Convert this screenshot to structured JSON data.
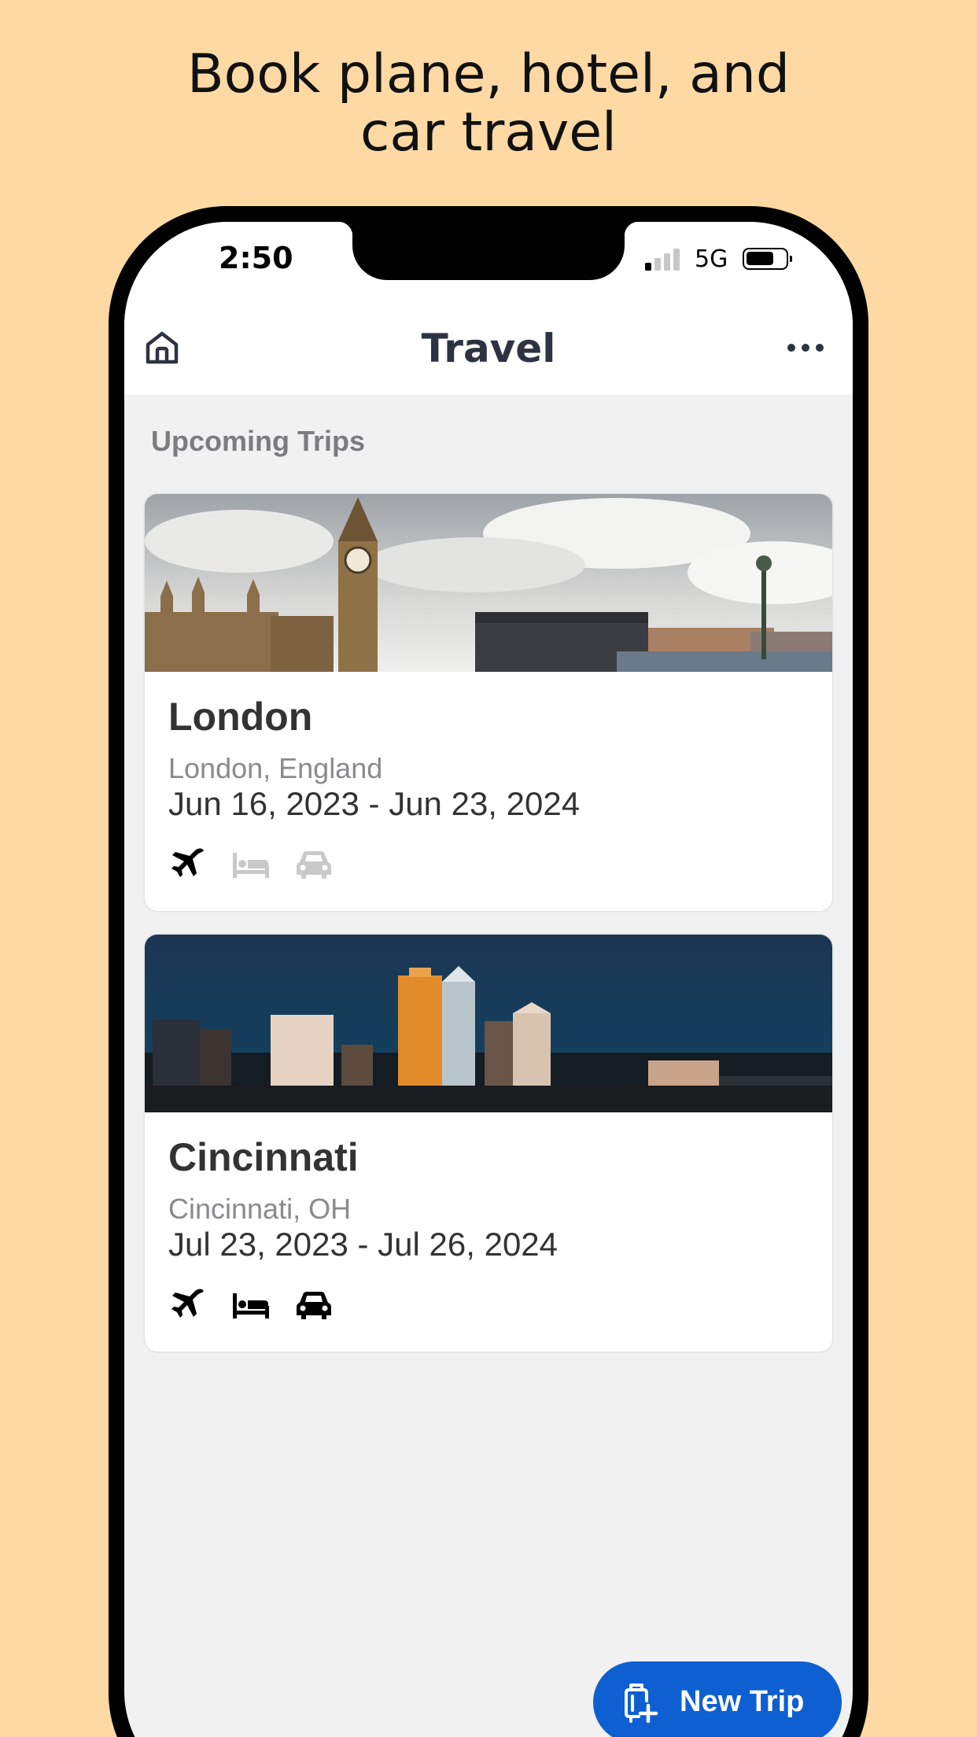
{
  "promo": {
    "line1": "Book plane, hotel, and",
    "line2": "car travel"
  },
  "status_bar": {
    "time": "2:50",
    "network": "5G",
    "signal_bars_active": 1,
    "signal_bars_total": 4
  },
  "navbar": {
    "title": "Travel",
    "left_icon": "home-icon",
    "right_icon": "more-horizontal-icon"
  },
  "section": {
    "title": "Upcoming Trips"
  },
  "trips": [
    {
      "title": "London",
      "location": "London, England",
      "dates": "Jun 16, 2023 - Jun 23, 2024",
      "image": "london-skyline",
      "bookings": {
        "flight": true,
        "hotel": false,
        "car": false
      }
    },
    {
      "title": "Cincinnati",
      "location": "Cincinnati, OH",
      "dates": "Jul 23, 2023 - Jul 26, 2024",
      "image": "cincinnati-skyline",
      "bookings": {
        "flight": true,
        "hotel": true,
        "car": true
      }
    }
  ],
  "fab": {
    "label": "New Trip",
    "icon": "luggage-add-icon"
  },
  "colors": {
    "background": "#fed9a4",
    "accent": "#0e5fd2",
    "icon_active": "#000000",
    "icon_inactive": "#c9c9c9"
  }
}
